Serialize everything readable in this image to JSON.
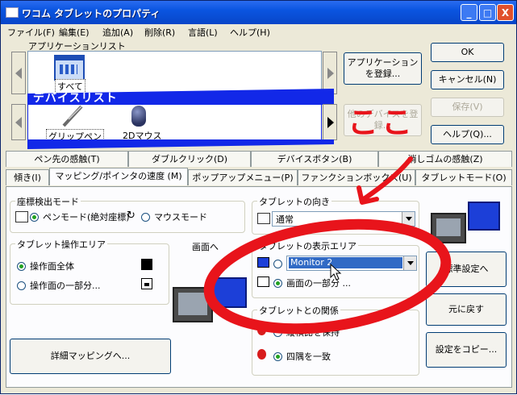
{
  "window": {
    "title": "ワコム タブレットのプロパティ",
    "minimize": "_",
    "maximize": "□",
    "close": "X"
  },
  "menus": [
    "ファイル(F)",
    "編集(E)",
    "追加(A)",
    "削除(R)",
    "言語(L)",
    "ヘルプ(H)"
  ],
  "app_list": {
    "label": "アプリケーションリスト",
    "items": [
      {
        "label": "すべて"
      }
    ]
  },
  "device_list": {
    "label": "デバイスリスト",
    "items": [
      {
        "label": "グリップペン"
      },
      {
        "label": "2Dマウス"
      }
    ]
  },
  "side_buttons": {
    "register_app": "アプリケーションを登録...",
    "add_device": "他のデバイスを登録...",
    "ok": "OK",
    "cancel": "キャンセル(N)",
    "save": "保存(V)",
    "help": "ヘルプ(Q)..."
  },
  "tabs_row1": [
    "ペン先の感触(T)",
    "ダブルクリック(D)",
    "デバイスボタン(B)",
    "消しゴムの感触(Z)"
  ],
  "tabs_row2": [
    "傾き(I)",
    "マッピング/ポインタの速度 (M)",
    "ポップアップメニュー(P)",
    "ファンクションボックス(U)",
    "タブレットモード(O)"
  ],
  "coord_mode": {
    "title": "座標検出モード",
    "pen_mode": "ペンモード(絶対座標)",
    "mouse_mode": "マウスモード"
  },
  "tablet_area": {
    "title": "タブレット操作エリア",
    "full": "操作面全体",
    "part": "操作面の一部分..."
  },
  "screen_label": "画面へ",
  "detail_mapping": "詳細マッピングへ...",
  "orientation": {
    "title": "タブレットの向き",
    "value": "通常"
  },
  "display_area": {
    "title": "タブレットの表示エリア",
    "monitor_value": "Monitor 2",
    "part": "画面の一部分 ..."
  },
  "relation": {
    "title": "タブレットとの関係",
    "keep_ratio": "縦横比を保持",
    "corners": "四隅を一致"
  },
  "right_buttons": {
    "standard": "標準設定へ",
    "restore": "元に戻す",
    "copy": "設定をコピー..."
  },
  "annotation": {
    "text": "ここ",
    "color": "#e8141b"
  },
  "colors": {
    "title_blue": "#0a55e0",
    "device_bar": "#1228e8",
    "annotation_red": "#e8141b"
  }
}
